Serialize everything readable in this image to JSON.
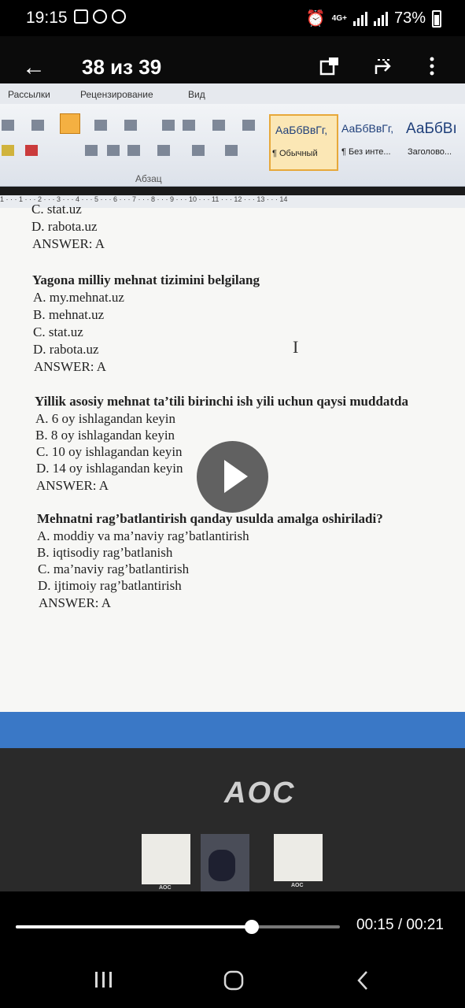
{
  "status": {
    "time": "19:15",
    "network": "4G+",
    "battery": "73%"
  },
  "app_bar": {
    "title": "38 из 39"
  },
  "word": {
    "tabs": [
      "Рассылки",
      "Рецензирование",
      "Вид"
    ],
    "group_label": "Абзац",
    "styles": [
      {
        "sample": "АаБбВвГг,",
        "name": "¶ Обычный"
      },
      {
        "sample": "АаБбВвГг,",
        "name": "¶ Без инте..."
      },
      {
        "sample": "АаБбВı",
        "name": "Заголово..."
      }
    ],
    "ruler": "1 · · · 1 · · · 2 · · · 3 · · · 4 · · · 5 · · · 6 · · · 7 · · · 8 · · · 9 · · · 10 · · · 11 · · · 12 · · · 13 · · · 14"
  },
  "document": {
    "lines": [
      {
        "text": "C. stat.uz"
      },
      {
        "text": "D. rabota.uz"
      },
      {
        "text": "ANSWER: A"
      },
      {
        "text": "Yagona milliy mehnat tizimini belgilang",
        "q": true
      },
      {
        "text": "A. my.mehnat.uz"
      },
      {
        "text": "B. mehnat.uz"
      },
      {
        "text": "C. stat.uz"
      },
      {
        "text": "D. rabota.uz"
      },
      {
        "text": "ANSWER: A"
      },
      {
        "text": "Yillik asosiy mehnat ta’tili birinchi ish yili uchun qaysi muddatda",
        "q": true
      },
      {
        "text": "A. 6 oy ishlagandan keyin"
      },
      {
        "text": "B. 8 oy ishlagandan keyin"
      },
      {
        "text": "C. 10 oy ishlagandan keyin"
      },
      {
        "text": "D. 14 oy ishlagandan keyin"
      },
      {
        "text": "ANSWER: A"
      },
      {
        "text": "Mehnatni rag’batlantirish qanday usulda amalga oshiriladi?",
        "q": true
      },
      {
        "text": "A. moddiy va ma’naviy rag’batlantirish"
      },
      {
        "text": "B. iqtisodiy rag’batlanish"
      },
      {
        "text": "C. ma’naviy rag’batlantirish"
      },
      {
        "text": "D. ijtimoiy rag’batlantirish"
      },
      {
        "text": "ANSWER: A"
      }
    ]
  },
  "monitor_brand": "AOC",
  "thumb_brand": "AOC",
  "video": {
    "elapsed": "00:15",
    "duration": "00:21",
    "progress": 0.727
  }
}
